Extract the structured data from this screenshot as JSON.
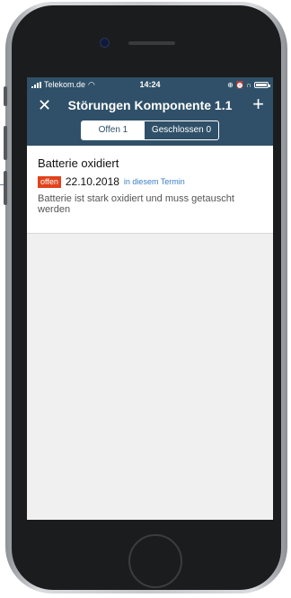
{
  "statusbar": {
    "carrier": "Telekom.de",
    "time": "14:24",
    "right_icons": "⊕ ⏰ ∩"
  },
  "navbar": {
    "title": "Störungen Komponente 1.1",
    "close_glyph": "✕",
    "add_glyph": "+"
  },
  "tabs": [
    {
      "label": "Offen 1",
      "active": true
    },
    {
      "label": "Geschlossen 0",
      "active": false
    }
  ],
  "issues": [
    {
      "title": "Batterie oxidiert",
      "status": "offen",
      "date": "22.10.2018",
      "link": "in diesem Termin",
      "description": "Batterie ist stark oxidiert und muss getauscht werden"
    }
  ],
  "colors": {
    "primary": "#2f5068",
    "badge": "#e0431c",
    "link": "#3a7fc8"
  }
}
